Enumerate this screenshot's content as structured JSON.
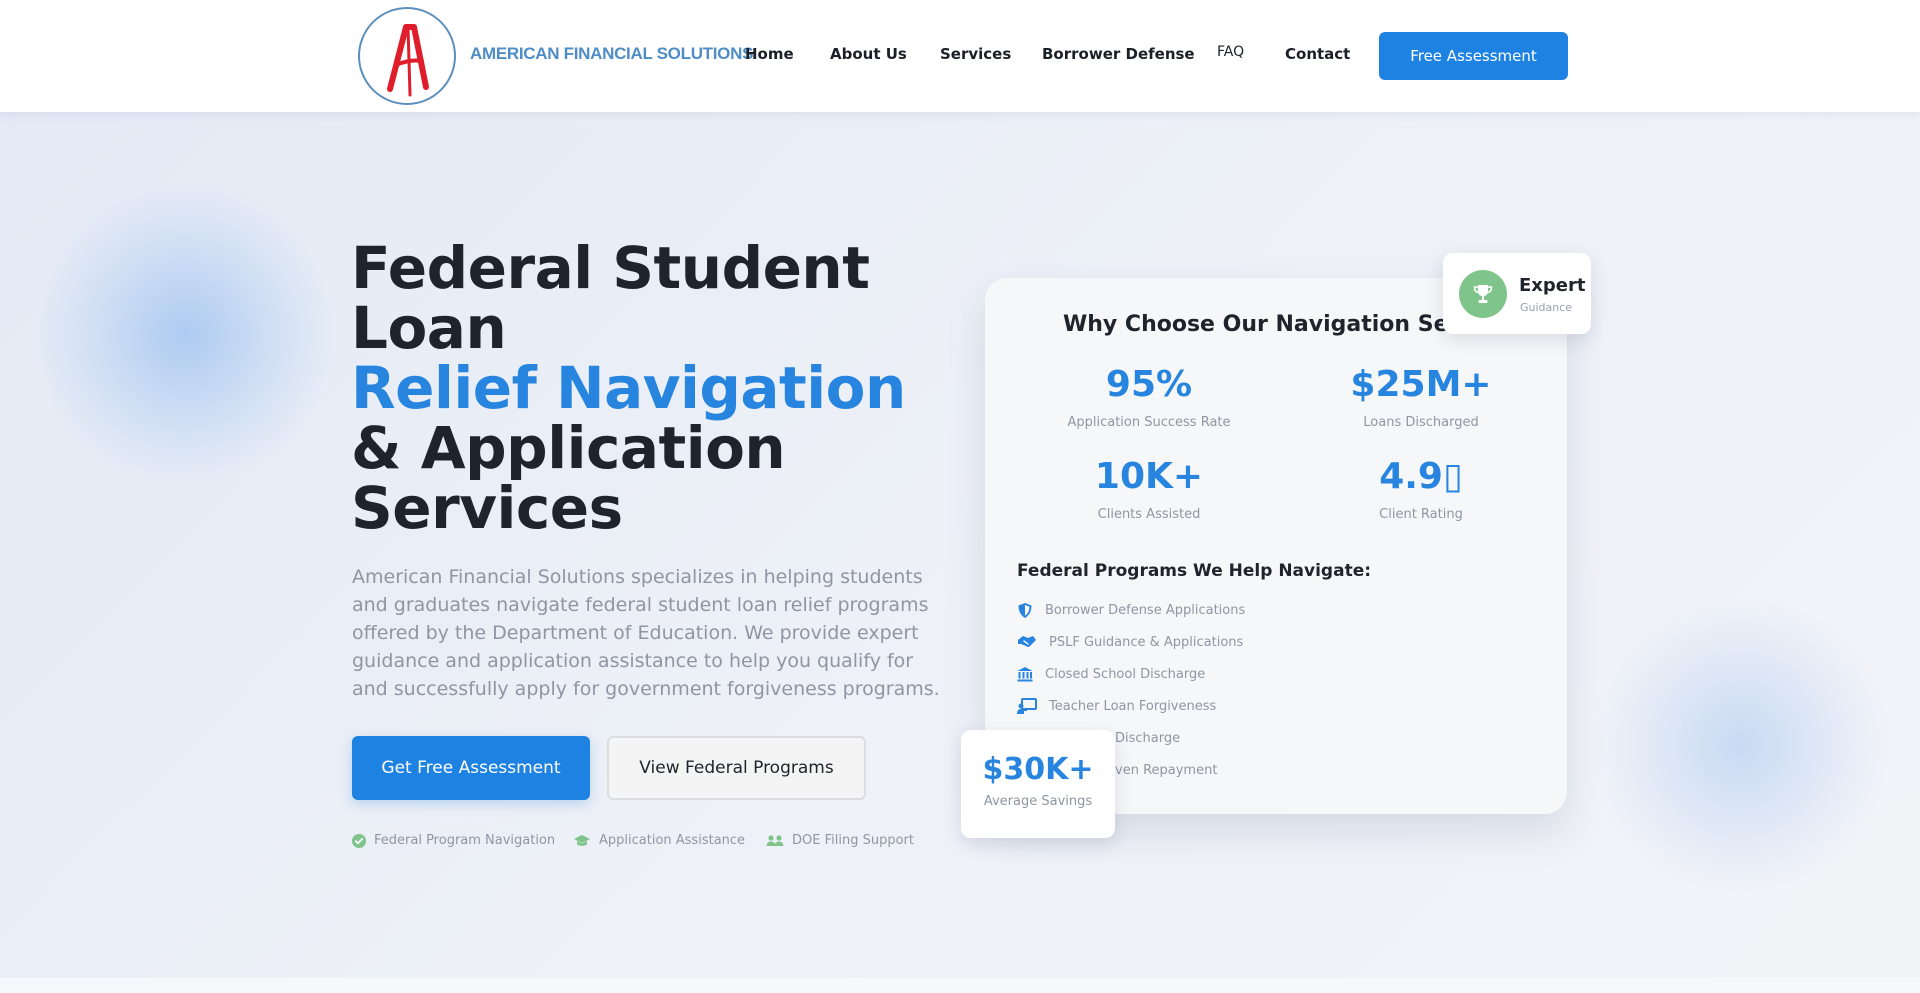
{
  "brand": {
    "logo_letter": "A",
    "name": "AMERICAN FINANCIAL SOLUTIONS"
  },
  "nav": {
    "items": [
      "Home",
      "About Us",
      "Services",
      "Borrower Defense",
      "FAQ",
      "Contact"
    ],
    "cta": "Free Assessment"
  },
  "hero": {
    "title_line1": "Federal Student",
    "title_line2": "Loan",
    "title_line3": "Relief Navigation",
    "title_line4": "& Application",
    "title_line5": "Services",
    "description": "American Financial Solutions specializes in helping students and graduates navigate federal student loan relief programs offered by the Department of Education. We provide expert guidance and application assistance to help you qualify for and successfully apply for government forgiveness programs.",
    "primary_button": "Get Free Assessment",
    "secondary_button": "View Federal Programs",
    "features": [
      {
        "label": "Federal Program Navigation",
        "icon": "check-circle-icon"
      },
      {
        "label": "Application Assistance",
        "icon": "graduation-cap-icon"
      },
      {
        "label": "DOE Filing Support",
        "icon": "users-icon"
      }
    ]
  },
  "card": {
    "title": "Why Choose Our Navigation Services",
    "stats": [
      {
        "value": "95%",
        "label": "Application Success Rate"
      },
      {
        "value": "$25M+",
        "label": "Loans Discharged"
      },
      {
        "value": "10K+",
        "label": "Clients Assisted"
      },
      {
        "value": "4.9",
        "glyph": "▯",
        "label": "Client Rating"
      }
    ],
    "programs_title": "Federal Programs We Help Navigate:",
    "programs": [
      {
        "label": "Borrower Defense Applications",
        "icon": "shield-icon"
      },
      {
        "label": "PSLF Guidance & Applications",
        "icon": "handshake-icon"
      },
      {
        "label": "Closed School Discharge",
        "icon": "school-building-icon"
      },
      {
        "label": "Teacher Loan Forgiveness",
        "icon": "chalkboard-teacher-icon"
      },
      {
        "label": "Discharge",
        "icon": "document-icon"
      },
      {
        "label": "ven Repayment",
        "icon": "calendar-icon"
      }
    ]
  },
  "badges": {
    "expert_title": "Expert",
    "expert_sub": "Guidance",
    "savings_value": "$30K+",
    "savings_label": "Average Savings"
  },
  "colors": {
    "accent": "#2785df",
    "button": "#1e82e3",
    "brand_text": "#4f8dc7",
    "logo_red": "#e01d2b",
    "success_green": "#7fc48a"
  }
}
